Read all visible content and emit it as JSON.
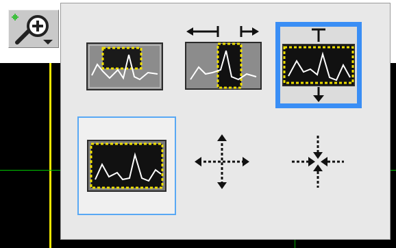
{
  "toolbar": {
    "zoom_tool": {
      "icon": "zoom-in-magnifier-icon",
      "has_dropdown": true
    }
  },
  "zoom_palette": {
    "options": [
      {
        "icon": "zoom-rectangle-icon",
        "selected": false
      },
      {
        "icon": "x-zoom-icon",
        "selected": false
      },
      {
        "icon": "y-zoom-icon",
        "selected": true
      },
      {
        "icon": "zoom-to-fit-icon",
        "selected": false,
        "hovered": true
      },
      {
        "icon": "zoom-in-about-point-icon",
        "selected": false
      },
      {
        "icon": "zoom-out-about-point-icon",
        "selected": false
      }
    ]
  },
  "colors": {
    "selection_border": "#3a8ef5",
    "hover_border": "#58a8f4",
    "graph_background": "#000000",
    "cursor_line": "#f2e600",
    "grid_line": "#00c800"
  }
}
